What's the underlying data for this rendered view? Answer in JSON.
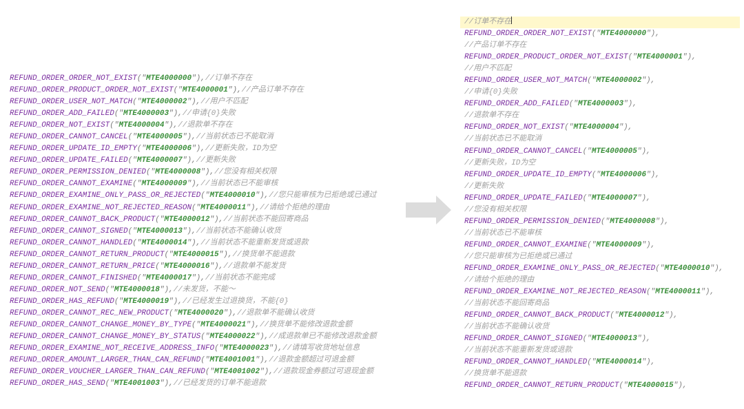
{
  "left": {
    "entries": [
      {
        "name": "REFUND_ORDER_ORDER_NOT_EXIST",
        "code": "MTE4000000",
        "comment": "订单不存在"
      },
      {
        "name": "REFUND_ORDER_PRODUCT_ORDER_NOT_EXIST",
        "code": "MTE4000001",
        "comment": "产品订单不存在"
      },
      {
        "name": "REFUND_ORDER_USER_NOT_MATCH",
        "code": "MTE4000002",
        "comment": "用户不匹配"
      },
      {
        "name": "REFUND_ORDER_ADD_FAILED",
        "code": "MTE4000003",
        "comment": "申请{0}失败"
      },
      {
        "name": "REFUND_ORDER_NOT_EXIST",
        "code": "MTE4000004",
        "comment": "退款单不存在"
      },
      {
        "name": "REFUND_ORDER_CANNOT_CANCEL",
        "code": "MTE4000005",
        "comment": "当前状态已不能取消"
      },
      {
        "name": "REFUND_ORDER_UPDATE_ID_EMPTY",
        "code": "MTE4000006",
        "comment": "更新失败，ID为空"
      },
      {
        "name": "REFUND_ORDER_UPDATE_FAILED",
        "code": "MTE4000007",
        "comment": "更新失败"
      },
      {
        "name": "REFUND_ORDER_PERMISSION_DENIED",
        "code": "MTE4000008",
        "comment": "您没有相关权限"
      },
      {
        "name": "REFUND_ORDER_CANNOT_EXAMINE",
        "code": "MTE4000009",
        "comment": "当前状态已不能审核"
      },
      {
        "name": "REFUND_ORDER_EXAMINE_ONLY_PASS_OR_REJECTED",
        "code": "MTE4000010",
        "comment": "您只能审核为已拒绝或已通过"
      },
      {
        "name": "REFUND_ORDER_EXAMINE_NOT_REJECTED_REASON",
        "code": "MTE4000011",
        "comment": "请给个拒绝的理由"
      },
      {
        "name": "REFUND_ORDER_CANNOT_BACK_PRODUCT",
        "code": "MTE4000012",
        "comment": "当前状态不能回寄商品"
      },
      {
        "name": "REFUND_ORDER_CANNOT_SIGNED",
        "code": "MTE4000013",
        "comment": "当前状态不能确认收货"
      },
      {
        "name": "REFUND_ORDER_CANNOT_HANDLED",
        "code": "MTE4000014",
        "comment": "当前状态不能重新发货或退款"
      },
      {
        "name": "REFUND_ORDER_CANNOT_RETURN_PRODUCT",
        "code": "MTE4000015",
        "comment": "换货单不能退款"
      },
      {
        "name": "REFUND_ORDER_CANNOT_RETURN_PRICE",
        "code": "MTE4000016",
        "comment": "退款单不能发货"
      },
      {
        "name": "REFUND_ORDER_CANNOT_FINISHED",
        "code": "MTE4000017",
        "comment": "当前状态不能完成"
      },
      {
        "name": "REFUND_ORDER_NOT_SEND",
        "code": "MTE4000018",
        "comment": "未发货，不能〜"
      },
      {
        "name": "REFUND_ORDER_HAS_REFUND",
        "code": "MTE4000019",
        "comment": "已经发生过退换货，不能{0}"
      },
      {
        "name": "REFUND_ORDER_CANNOT_REC_NEW_PRODUCT",
        "code": "MTE4000020",
        "comment": "退款单不能确认收货"
      },
      {
        "name": "REFUND_ORDER_CANNOT_CHANGE_MONEY_BY_TYPE",
        "code": "MTE4000021",
        "comment": "换货单不能修改退款金额"
      },
      {
        "name": "REFUND_ORDER_CANNOT_CHANGE_MONEY_BY_STATUS",
        "code": "MTE4000022",
        "comment": "成退款单已不能修改退款金额"
      },
      {
        "name": "REFUND_ORDER_EXAMINE_NOT_RECEIVE_ADDRESS_INFO",
        "code": "MTE4000023",
        "comment": "请填写收货地址信息"
      },
      {
        "name": "REFUND_ORDER_AMOUNT_LARGER_THAN_CAN_REFUND",
        "code": "MTE4001001",
        "comment": "退款金额超过可退金额"
      },
      {
        "name": "REFUND_ORDER_VOUCHER_LARGER_THAN_CAN_REFUND",
        "code": "MTE4001002",
        "comment": "退款现金券额过可退现金额"
      },
      {
        "name": "REFUND_ORDER_HAS_SEND",
        "code": "MTE4001003",
        "comment": "已经发货的订单不能退款"
      }
    ],
    "format": {
      "paren_open": "(",
      "paren_close": ")",
      "quote": "\"",
      "tail": ",//",
      "slashslash": "//"
    }
  },
  "right": {
    "lines": [
      {
        "type": "comment",
        "text": "//订单不存在",
        "highlight": true,
        "caret": true
      },
      {
        "type": "enum",
        "name": "REFUND_ORDER_ORDER_NOT_EXIST",
        "code": "MTE4000000"
      },
      {
        "type": "comment",
        "text": "//产品订单不存在"
      },
      {
        "type": "enum",
        "name": "REFUND_ORDER_PRODUCT_ORDER_NOT_EXIST",
        "code": "MTE4000001"
      },
      {
        "type": "comment",
        "text": "//用户不匹配"
      },
      {
        "type": "enum",
        "name": "REFUND_ORDER_USER_NOT_MATCH",
        "code": "MTE4000002"
      },
      {
        "type": "comment",
        "text": "//申请{0}失败"
      },
      {
        "type": "enum",
        "name": "REFUND_ORDER_ADD_FAILED",
        "code": "MTE4000003"
      },
      {
        "type": "comment",
        "text": "//退款单不存在"
      },
      {
        "type": "enum",
        "name": "REFUND_ORDER_NOT_EXIST",
        "code": "MTE4000004"
      },
      {
        "type": "comment",
        "text": "//当前状态已不能取消"
      },
      {
        "type": "enum",
        "name": "REFUND_ORDER_CANNOT_CANCEL",
        "code": "MTE4000005"
      },
      {
        "type": "comment",
        "text": "//更新失败，ID为空"
      },
      {
        "type": "enum",
        "name": "REFUND_ORDER_UPDATE_ID_EMPTY",
        "code": "MTE4000006"
      },
      {
        "type": "comment",
        "text": "//更新失败"
      },
      {
        "type": "enum",
        "name": "REFUND_ORDER_UPDATE_FAILED",
        "code": "MTE4000007"
      },
      {
        "type": "comment",
        "text": "//您没有相关权限"
      },
      {
        "type": "enum",
        "name": "REFUND_ORDER_PERMISSION_DENIED",
        "code": "MTE4000008"
      },
      {
        "type": "comment",
        "text": "//当前状态已不能审核"
      },
      {
        "type": "enum",
        "name": "REFUND_ORDER_CANNOT_EXAMINE",
        "code": "MTE4000009"
      },
      {
        "type": "comment",
        "text": "//您只能审核为已拒绝或已通过"
      },
      {
        "type": "enum",
        "name": "REFUND_ORDER_EXAMINE_ONLY_PASS_OR_REJECTED",
        "code": "MTE4000010"
      },
      {
        "type": "comment",
        "text": "//请给个拒绝的理由"
      },
      {
        "type": "enum",
        "name": "REFUND_ORDER_EXAMINE_NOT_REJECTED_REASON",
        "code": "MTE4000011"
      },
      {
        "type": "comment",
        "text": "//当前状态不能回寄商品"
      },
      {
        "type": "enum",
        "name": "REFUND_ORDER_CANNOT_BACK_PRODUCT",
        "code": "MTE4000012"
      },
      {
        "type": "comment",
        "text": "//当前状态不能确认收货"
      },
      {
        "type": "enum",
        "name": "REFUND_ORDER_CANNOT_SIGNED",
        "code": "MTE4000013"
      },
      {
        "type": "comment",
        "text": "//当前状态不能重新发货或退款"
      },
      {
        "type": "enum",
        "name": "REFUND_ORDER_CANNOT_HANDLED",
        "code": "MTE4000014"
      },
      {
        "type": "comment",
        "text": "//换货单不能退款"
      },
      {
        "type": "enum",
        "name": "REFUND_ORDER_CANNOT_RETURN_PRODUCT",
        "code": "MTE4000015"
      }
    ],
    "format": {
      "paren_open": "(",
      "paren_close": ")",
      "quote": "\"",
      "trail": ","
    }
  }
}
